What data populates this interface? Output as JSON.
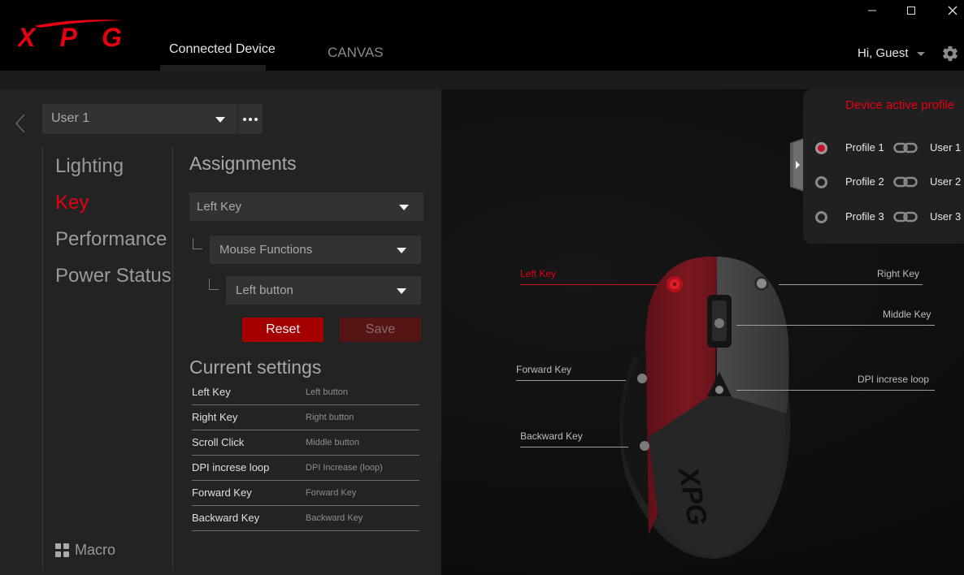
{
  "window": {
    "controls": {
      "minimize": "minimize-icon",
      "maximize": "maximize-icon",
      "close": "close-icon"
    }
  },
  "header": {
    "logo_text": "XPG",
    "tabs": [
      {
        "label": "Connected Device",
        "active": true
      },
      {
        "label": "CANVAS",
        "active": false
      }
    ],
    "greeting": "Hi, Guest",
    "settings_icon": "gear-icon"
  },
  "colors": {
    "accent": "#e60012",
    "reset_button": "#a50000",
    "save_button": "#561414",
    "panel_bg": "#232323",
    "control_bg": "#323232"
  },
  "left_panel": {
    "user_profile_select": {
      "value": "User 1"
    },
    "more_button": "more-icon",
    "nav": [
      {
        "label": "Lighting",
        "active": false
      },
      {
        "label": "Key",
        "active": true
      },
      {
        "label": "Performance",
        "active": false
      },
      {
        "label": "Power Status",
        "active": false
      }
    ],
    "macro_label": "Macro"
  },
  "assignments": {
    "title": "Assignments",
    "key_select": "Left Key",
    "function_category_select": "Mouse Functions",
    "function_select": "Left button",
    "reset_label": "Reset",
    "save_label": "Save"
  },
  "current_settings": {
    "title": "Current settings",
    "rows": [
      {
        "name": "Left Key",
        "value": "Left button"
      },
      {
        "name": "Right Key",
        "value": "Right button"
      },
      {
        "name": "Scroll Click",
        "value": "Middle button"
      },
      {
        "name": "DPI increse loop",
        "value": "DPI Increase (loop)"
      },
      {
        "name": "Forward Key",
        "value": "Forward Key"
      },
      {
        "name": "Backward Key",
        "value": "Backward Key"
      }
    ]
  },
  "device_profile": {
    "title": "Device active profile",
    "profiles": [
      {
        "name": "Profile 1",
        "user": "User 1",
        "selected": true
      },
      {
        "name": "Profile 2",
        "user": "User 2",
        "selected": false
      },
      {
        "name": "Profile 3",
        "user": "User 3",
        "selected": false
      }
    ]
  },
  "mouse_callouts": {
    "left_key": "Left Key",
    "right_key": "Right Key",
    "middle_key": "Middle Key",
    "forward_key": "Forward Key",
    "dpi_key": "DPI increse loop",
    "backward_key": "Backward Key",
    "active": "left_key"
  }
}
